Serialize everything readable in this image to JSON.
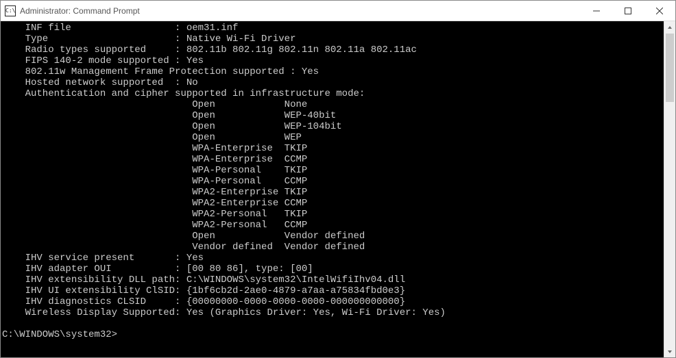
{
  "window": {
    "title": "Administrator: Command Prompt",
    "icon_text": "C:\\"
  },
  "terminal": {
    "indent": "    ",
    "col1_width": 30,
    "auth_indent": 33,
    "auth_col_width": 16,
    "fields": [
      {
        "label": "INF file",
        "value": "oem31.inf"
      },
      {
        "label": "Type",
        "value": "Native Wi-Fi Driver"
      },
      {
        "label": "Radio types supported",
        "value": "802.11b 802.11g 802.11n 802.11a 802.11ac"
      },
      {
        "label": "FIPS 140-2 mode supported",
        "value": "Yes"
      }
    ],
    "mgmt_frame_line": "    802.11w Management Frame Protection supported : Yes",
    "hosted_network": {
      "label": "Hosted network supported",
      "value": "No"
    },
    "auth_header": "    Authentication and cipher supported in infrastructure mode:",
    "auth_rows": [
      {
        "auth": "Open",
        "cipher": "None"
      },
      {
        "auth": "Open",
        "cipher": "WEP-40bit"
      },
      {
        "auth": "Open",
        "cipher": "WEP-104bit"
      },
      {
        "auth": "Open",
        "cipher": "WEP"
      },
      {
        "auth": "WPA-Enterprise",
        "cipher": "TKIP"
      },
      {
        "auth": "WPA-Enterprise",
        "cipher": "CCMP"
      },
      {
        "auth": "WPA-Personal",
        "cipher": "TKIP"
      },
      {
        "auth": "WPA-Personal",
        "cipher": "CCMP"
      },
      {
        "auth": "WPA2-Enterprise",
        "cipher": "TKIP"
      },
      {
        "auth": "WPA2-Enterprise",
        "cipher": "CCMP"
      },
      {
        "auth": "WPA2-Personal",
        "cipher": "TKIP"
      },
      {
        "auth": "WPA2-Personal",
        "cipher": "CCMP"
      },
      {
        "auth": "Open",
        "cipher": "Vendor defined"
      },
      {
        "auth": "Vendor defined",
        "cipher": "Vendor defined"
      }
    ],
    "ihv_fields": [
      {
        "label": "IHV service present",
        "value": "Yes"
      },
      {
        "label": "IHV adapter OUI",
        "value": "[00 80 86], type: [00]"
      }
    ],
    "ihv_dll_line": "    IHV extensibility DLL path: C:\\WINDOWS\\system32\\IntelWifiIhv04.dll",
    "ihv_ui_line": "    IHV UI extensibility ClSID: {1bf6cb2d-2ae0-4879-a7aa-a75834fbd0e3}",
    "ihv_diag": {
      "label": "IHV diagnostics CLSID",
      "value": "{00000000-0000-0000-0000-000000000000}"
    },
    "wireless_line": "    Wireless Display Supported: Yes (Graphics Driver: Yes, Wi-Fi Driver: Yes)",
    "prompt": "C:\\WINDOWS\\system32>"
  }
}
